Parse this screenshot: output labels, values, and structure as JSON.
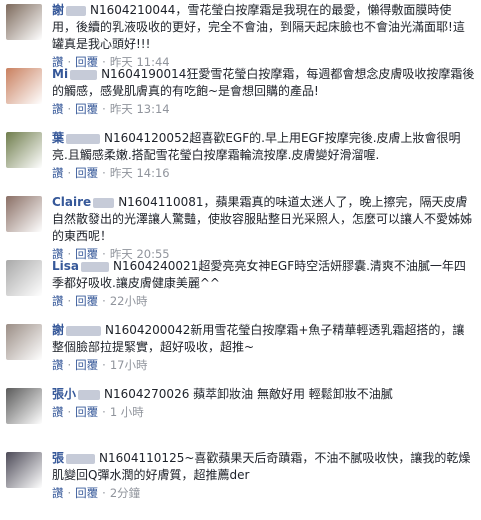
{
  "comments": [
    {
      "name": "謝",
      "text": "N1604210044，雪花瑩白按摩霜是我現在的最愛，懶得敷面膜時使用，後續的乳液吸收的更好，完全不會油，到隔天起床臉也不會油光滿面耶!這罐真是我心頭好!!!",
      "like": "讚",
      "reply": "回覆",
      "time": "昨天 11:44",
      "avatar_color": "#7d6a5c",
      "name_blur_color": "#c6cbd8"
    },
    {
      "name": "Mi",
      "text": "N1604190014狂愛雪花瑩白按摩霜，每週都會想念皮膚吸收按摩霜後的觸感，感覺肌膚真的有吃飽~是會想回購的產品!",
      "like": "讚",
      "reply": "回覆",
      "time": "昨天 13:14",
      "avatar_color": "#c9805f",
      "name_blur_color": "#c6cbd8"
    },
    {
      "name": "葉",
      "text": "N1604120052超喜歡EGF的.早上用EGF按摩完後.皮膚上妝會很明亮.且觸感柔嫩.搭配雪花瑩白按摩霜輪流按摩.皮膚變好滑溜喔.",
      "like": "讚",
      "reply": "回覆",
      "time": "昨天 14:16",
      "avatar_color": "#6f7d4c",
      "name_blur_color": "#c6cbd8"
    },
    {
      "name": "Claire",
      "text": "N1604110081，蘋果霜真的味道太迷人了，晚上擦完，隔天皮膚自然散發出的光澤讓人驚豔，使妝容服貼整日光采照人，怎麼可以讓人不愛姊姊的東西呢！",
      "like": "讚",
      "reply": "回覆",
      "time": "昨天 20:55",
      "avatar_color": "#8a6f65",
      "name_blur_color": "#c6cbd8"
    },
    {
      "name": "Lisa",
      "text": "N1604240021超愛亮亮女神EGF時空活妍膠囊.清爽不油膩一年四季都好吸收.讓皮膚健康美麗^^",
      "like": "讚",
      "reply": "回覆",
      "time": "22小時",
      "avatar_color": "#a9a9a9",
      "name_blur_color": "#c6cbd8"
    },
    {
      "name": "謝",
      "text": "N1604200042新用雪花瑩白按摩霜+魚子精華輕透乳霜超搭的，讓整個臉部拉提緊實，超好吸收，超推~",
      "like": "讚",
      "reply": "回覆",
      "time": "17小時",
      "avatar_color": "#9b8e86",
      "name_blur_color": "#c6cbd8"
    },
    {
      "name": "張小",
      "text": "N1604270026 蘋萃卸妝油 無敵好用 輕鬆卸妝不油膩",
      "like": "讚",
      "reply": "回覆",
      "time": "1 小時",
      "avatar_color": "#5a5a5a",
      "name_blur_color": "#c6cbd8"
    },
    {
      "name": "張",
      "text": "N1604110125~喜歡蘋果天后奇蹟霜，不油不膩吸收快，讓我的乾燥肌變回Q彈水潤的好膚質，超推薦der",
      "like": "讚",
      "reply": "回覆",
      "time": "2分鐘",
      "avatar_color": "#4c4a57",
      "name_blur_color": "#c6cbd8"
    }
  ]
}
